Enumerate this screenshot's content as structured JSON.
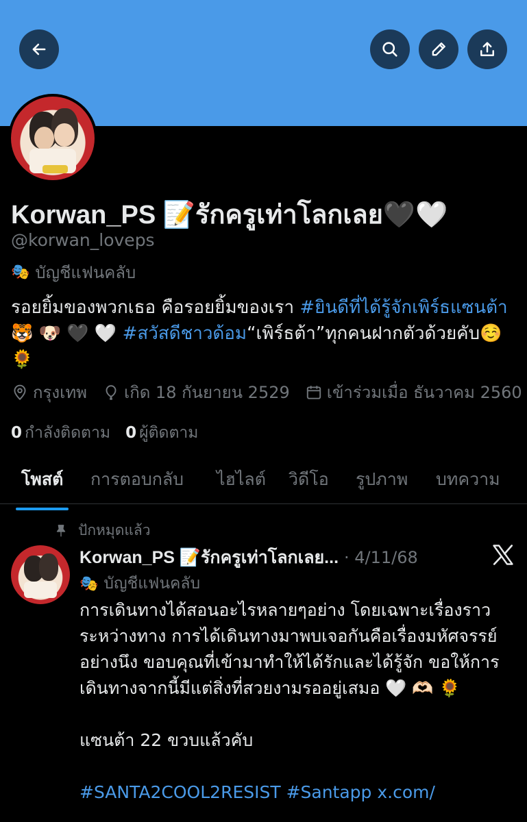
{
  "header": {
    "back_icon": "arrow-left-icon",
    "search_icon": "search-icon",
    "edit_icon": "pencil-icon",
    "share_icon": "share-icon",
    "banner_color": "#4a9ae8"
  },
  "profile": {
    "display_name": "Korwan_PS 📝รักครูเท่าโลกเลย🖤🤍",
    "handle": "@korwan_loveps",
    "fan_account_label": "บัญชีแฟนคลับ",
    "fan_icon": "🎭",
    "bio_text_1": "รอยยิ้มของพวกเธอ คือรอยยิ้มของเรา ",
    "bio_tag_1": "#ยินดีที่ได้รู้จักเพิร์ธแซนต้า",
    "bio_text_2": " 🐯 🐶 🖤 🤍 ",
    "bio_tag_2": "#สวัสดีชาวด้อม",
    "bio_text_3": "“เพิร์ธต้า”ทุกคนฝากตัวด้วยคับ☺️ 🌻",
    "location": "กรุงเทพ",
    "birth": "เกิด 18 กันยายน 2529",
    "joined": "เข้าร่วมเมื่อ ธันวาคม 2560",
    "following_count": "0",
    "following_label": "กำลังติดตาม",
    "followers_count": "0",
    "followers_label": "ผู้ติดตาม"
  },
  "tabs": [
    {
      "label": "โพสต์",
      "active": true
    },
    {
      "label": "การตอบกลับ",
      "active": false
    },
    {
      "label": "ไฮไลต์",
      "active": false
    },
    {
      "label": "วิดีโอ",
      "active": false
    },
    {
      "label": "รูปภาพ",
      "active": false
    },
    {
      "label": "บทความ",
      "active": false
    }
  ],
  "pinned_post": {
    "pinned_label": "ปักหมุดแล้ว",
    "author": "Korwan_PS 📝รักครูเท่าโลกเลย...",
    "date": "· 4/11/68",
    "fan_label": "บัญชีแฟนคลับ",
    "line_1": "การเดินทางได้สอนอะไรหลายๆอย่าง โดยเฉพาะเรื่องราวระหว่างทาง การได้เดินทางมาพบเจอกันคือเรื่องมหัศจรรย์อย่างนึง ขอบคุณที่เข้ามาทำให้ได้รักและได้รู้จัก ขอให้การเดินทางจากนี้มีแต่สิ่งที่สวยงามรออยู่เสมอ 🤍 🫶🏻 🌻",
    "line_2": "แซนต้า 22 ขวบแล้วคับ",
    "tags": "#SANTA2COOL2RESIST #Santapp x.com/"
  }
}
